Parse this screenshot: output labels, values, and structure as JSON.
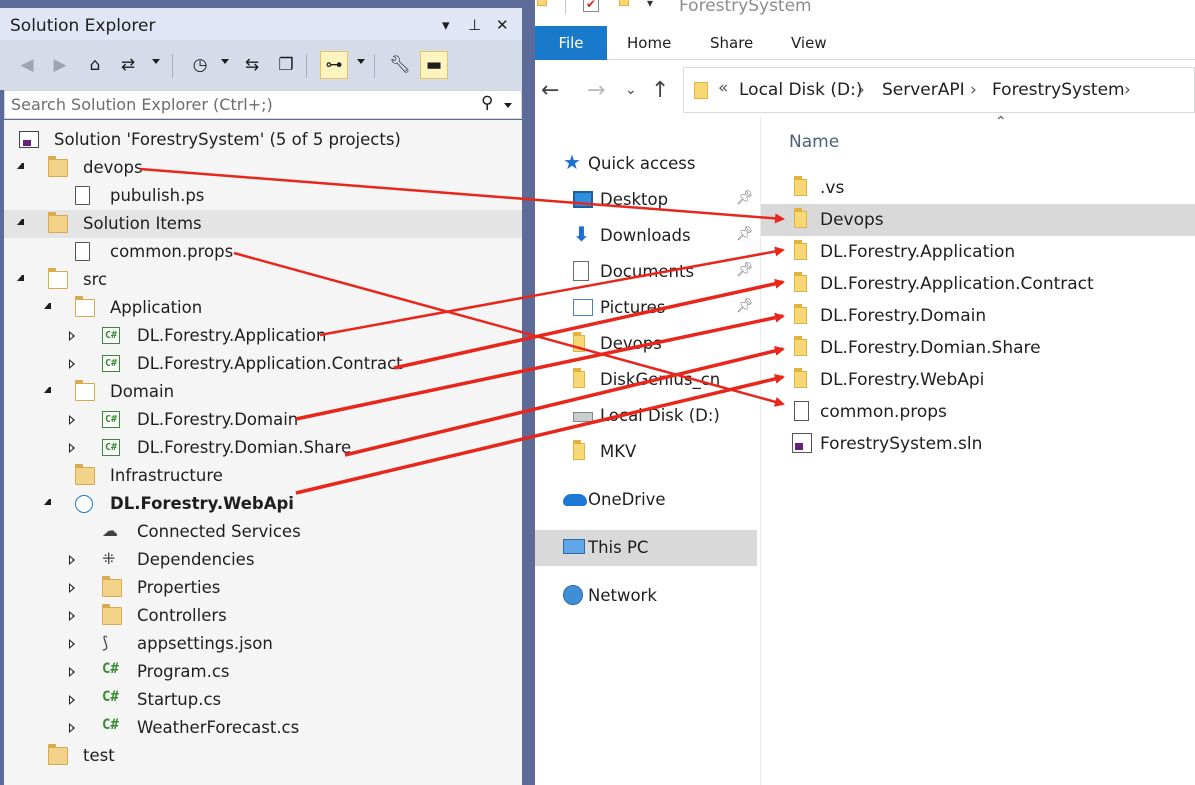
{
  "solution_explorer": {
    "title": "Solution Explorer",
    "search_placeholder": "Search Solution Explorer (Ctrl+;)",
    "tree": [
      {
        "label": "Solution 'ForestrySystem' (5 of 5 projects)",
        "icon": "solution-icon",
        "expander": "none",
        "indent": 0
      },
      {
        "label": "devops",
        "icon": "folder-icon",
        "expander": "open",
        "indent": 1
      },
      {
        "label": "pubulish.ps",
        "icon": "file-icon",
        "expander": "none",
        "indent": 2
      },
      {
        "label": "Solution Items",
        "icon": "folder-icon",
        "expander": "open",
        "indent": 1,
        "selected": true
      },
      {
        "label": "common.props",
        "icon": "props-file-icon",
        "expander": "none",
        "indent": 2
      },
      {
        "label": "src",
        "icon": "folder-open-icon",
        "expander": "open",
        "indent": 1
      },
      {
        "label": "Application",
        "icon": "folder-open-icon",
        "expander": "open",
        "indent": 2
      },
      {
        "label": "DL.Forestry.Application",
        "icon": "csharp-project-icon",
        "expander": "closed",
        "indent": 3
      },
      {
        "label": "DL.Forestry.Application.Contract",
        "icon": "csharp-project-icon",
        "expander": "closed",
        "indent": 3
      },
      {
        "label": "Domain",
        "icon": "folder-open-icon",
        "expander": "open",
        "indent": 2
      },
      {
        "label": "DL.Forestry.Domain",
        "icon": "csharp-project-icon",
        "expander": "closed",
        "indent": 3
      },
      {
        "label": "DL.Forestry.Domian.Share",
        "icon": "csharp-project-icon",
        "expander": "closed",
        "indent": 3
      },
      {
        "label": "Infrastructure",
        "icon": "folder-icon",
        "expander": "none",
        "indent": 2
      },
      {
        "label": "DL.Forestry.WebApi",
        "icon": "web-project-icon",
        "expander": "open",
        "indent": 2,
        "bold": true
      },
      {
        "label": "Connected Services",
        "icon": "connected-services-icon",
        "expander": "none",
        "indent": 3
      },
      {
        "label": "Dependencies",
        "icon": "dependencies-icon",
        "expander": "closed",
        "indent": 3
      },
      {
        "label": "Properties",
        "icon": "properties-icon",
        "expander": "closed",
        "indent": 3
      },
      {
        "label": "Controllers",
        "icon": "folder-icon",
        "expander": "closed",
        "indent": 3
      },
      {
        "label": "appsettings.json",
        "icon": "json-file-icon",
        "expander": "closed",
        "indent": 3
      },
      {
        "label": "Program.cs",
        "icon": "csharp-file-icon",
        "expander": "closed",
        "indent": 3
      },
      {
        "label": "Startup.cs",
        "icon": "csharp-file-icon",
        "expander": "closed",
        "indent": 3
      },
      {
        "label": "WeatherForecast.cs",
        "icon": "csharp-file-icon",
        "expander": "closed",
        "indent": 3
      },
      {
        "label": "test",
        "icon": "folder-icon",
        "expander": "none",
        "indent": 1
      }
    ]
  },
  "file_explorer": {
    "window_title": "ForestrySystem",
    "ribbon_tabs": [
      "File",
      "Home",
      "Share",
      "View"
    ],
    "breadcrumb_overflow": "«",
    "breadcrumbs": [
      "Local Disk (D:)",
      "ServerAPI",
      "ForestrySystem"
    ],
    "nav_pane": [
      {
        "label": "Quick access",
        "icon": "star-icon",
        "level": 0
      },
      {
        "label": "Desktop",
        "icon": "desktop-icon",
        "level": 1,
        "pinned": true
      },
      {
        "label": "Downloads",
        "icon": "download-icon",
        "level": 1,
        "pinned": true
      },
      {
        "label": "Documents",
        "icon": "documents-icon",
        "level": 1,
        "pinned": true
      },
      {
        "label": "Pictures",
        "icon": "pictures-icon",
        "level": 1,
        "pinned": true
      },
      {
        "label": "Devops",
        "icon": "folder-icon",
        "level": 1
      },
      {
        "label": "DiskGenius_cn",
        "icon": "folder-icon",
        "level": 1
      },
      {
        "label": "Local Disk (D:)",
        "icon": "drive-icon",
        "level": 1
      },
      {
        "label": "MKV",
        "icon": "folder-icon",
        "level": 1
      },
      {
        "label": "OneDrive",
        "icon": "onedrive-icon",
        "level": 0
      },
      {
        "label": "This PC",
        "icon": "this-pc-icon",
        "level": 0,
        "selected": true
      },
      {
        "label": "Network",
        "icon": "network-icon",
        "level": 0
      }
    ],
    "column_header": "Name",
    "files": [
      {
        "label": ".vs",
        "icon": "folder-icon"
      },
      {
        "label": "Devops",
        "icon": "folder-icon",
        "selected": true
      },
      {
        "label": "DL.Forestry.Application",
        "icon": "folder-icon"
      },
      {
        "label": "DL.Forestry.Application.Contract",
        "icon": "folder-icon"
      },
      {
        "label": "DL.Forestry.Domain",
        "icon": "folder-icon"
      },
      {
        "label": "DL.Forestry.Domian.Share",
        "icon": "folder-icon"
      },
      {
        "label": "DL.Forestry.WebApi",
        "icon": "folder-icon"
      },
      {
        "label": "common.props",
        "icon": "props-file-icon"
      },
      {
        "label": "ForestrySystem.sln",
        "icon": "solution-file-icon"
      }
    ]
  },
  "colors": {
    "annotation_arrow": "#e8261c",
    "se_frame": "#5d6b99",
    "ribbon_file_tab": "#1979ca",
    "selection": "#d9d9d9"
  }
}
